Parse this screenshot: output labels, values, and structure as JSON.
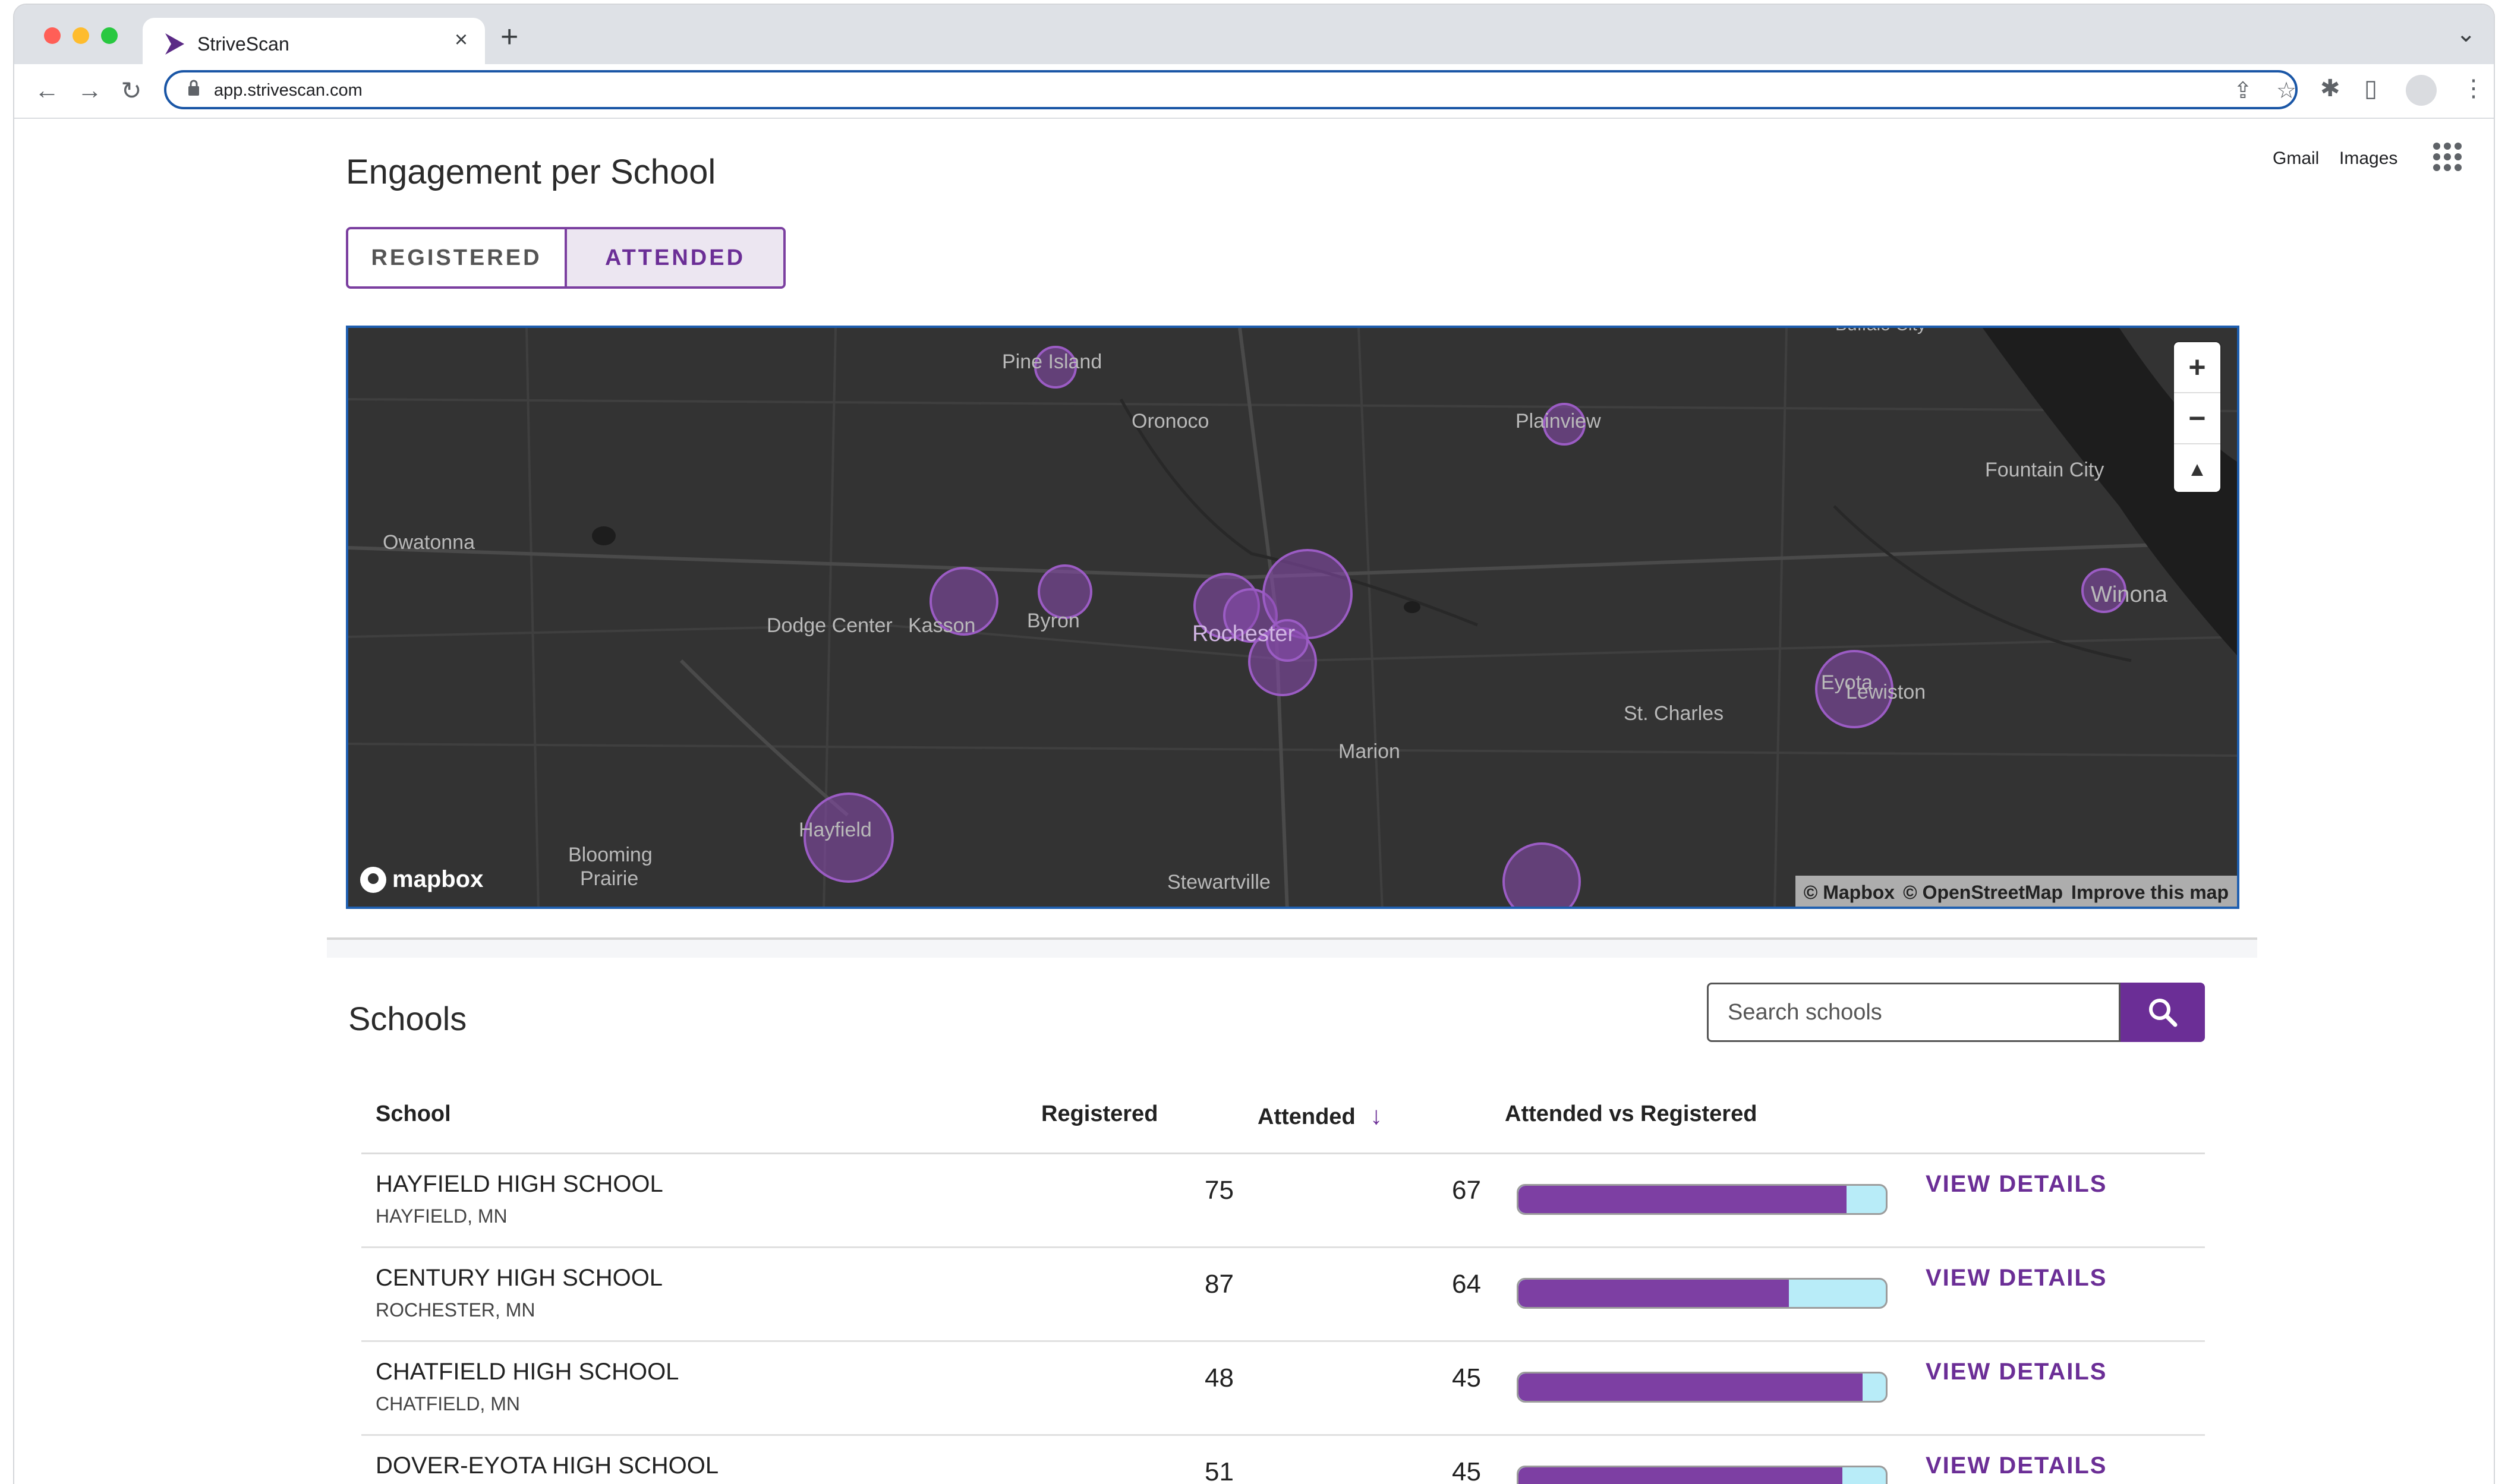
{
  "browser": {
    "tab_title": "StriveScan",
    "tab_close": "×",
    "new_tab": "+",
    "tab_list": "⌄",
    "url": "app.strivescan.com",
    "back": "←",
    "forward": "→",
    "reload": "↻",
    "share": "⇪",
    "bookmark": "☆",
    "extensions": "✱",
    "side_panel": "▯",
    "menu": "⋮"
  },
  "google_bar": {
    "gmail": "Gmail",
    "images": "Images"
  },
  "page_title": "Engagement per School",
  "toggle": {
    "registered": "REGISTERED",
    "attended": "ATTENDED",
    "active": "attended"
  },
  "map": {
    "labels": [
      {
        "text": "Pine Island"
      },
      {
        "text": "Oronoco"
      },
      {
        "text": "Plainview"
      },
      {
        "text": "Fountain City"
      },
      {
        "text": "Owatonna"
      },
      {
        "text": "Dodge Center"
      },
      {
        "text": "Kasson"
      },
      {
        "text": "Byron"
      },
      {
        "text": "Rochester"
      },
      {
        "text": "Winona"
      },
      {
        "text": "Eyota"
      },
      {
        "text": "St. Charles"
      },
      {
        "text": "Lewiston"
      },
      {
        "text": "Marion"
      },
      {
        "text": "Hayfield"
      },
      {
        "text": "Blooming"
      },
      {
        "text": "Prairie"
      },
      {
        "text": "Stewartville"
      },
      {
        "text": "Buffalo City"
      }
    ],
    "zoom_in": "+",
    "zoom_out": "−",
    "compass": "▲",
    "logo_text": "mapbox",
    "attribution": {
      "mapbox": "© Mapbox",
      "osm": "© OpenStreetMap",
      "improve": "Improve this map"
    },
    "marker_color": "#8a4bb0"
  },
  "schools_section": {
    "title": "Schools",
    "search_placeholder": "Search schools"
  },
  "table": {
    "headers": {
      "school": "School",
      "registered": "Registered",
      "attended": "Attended",
      "sort_arrow": "↓",
      "ratio": "Attended vs Registered"
    },
    "rows": [
      {
        "name": "HAYFIELD HIGH SCHOOL",
        "location": "HAYFIELD, MN",
        "registered": "75",
        "attended": "67",
        "ratio": 0.893,
        "action": "VIEW DETAILS"
      },
      {
        "name": "CENTURY HIGH SCHOOL",
        "location": "ROCHESTER, MN",
        "registered": "87",
        "attended": "64",
        "ratio": 0.736,
        "action": "VIEW DETAILS"
      },
      {
        "name": "CHATFIELD HIGH SCHOOL",
        "location": "CHATFIELD, MN",
        "registered": "48",
        "attended": "45",
        "ratio": 0.9375,
        "action": "VIEW DETAILS"
      },
      {
        "name": "DOVER-EYOTA HIGH SCHOOL",
        "location": "",
        "registered": "51",
        "attended": "45",
        "ratio": 0.882,
        "action": "VIEW DETAILS"
      }
    ]
  },
  "colors": {
    "brand": "#6b2e96",
    "bar_fill": "#7d3fa3",
    "bar_track": "#b8ecf8",
    "map_bg": "#333333"
  }
}
